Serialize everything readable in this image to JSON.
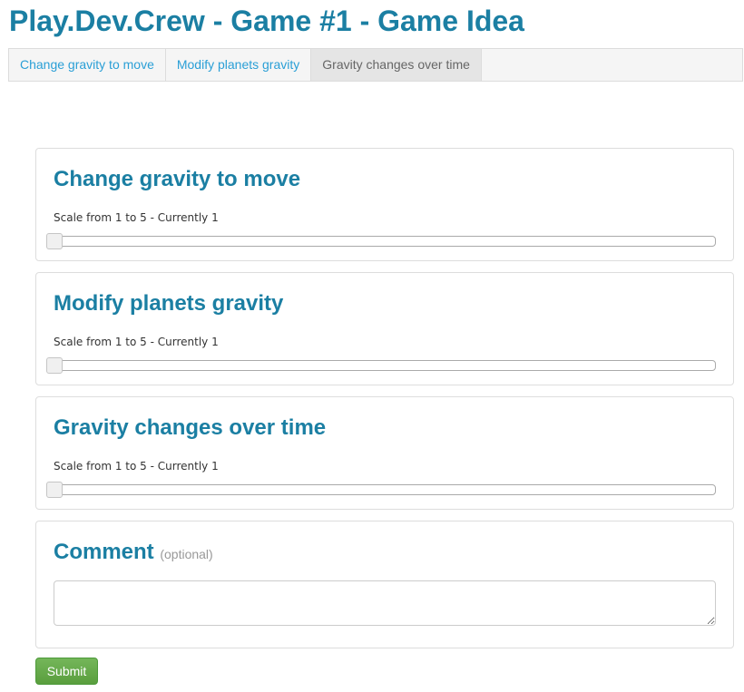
{
  "page": {
    "title": "Play.Dev.Crew - Game #1 - Game Idea"
  },
  "tabs": [
    {
      "label": "Change gravity to move",
      "active": false
    },
    {
      "label": "Modify planets gravity",
      "active": false
    },
    {
      "label": "Gravity changes over time",
      "active": true
    }
  ],
  "sections": [
    {
      "title": "Change gravity to move",
      "scale_label": "Scale from 1 to 5 - Currently 1",
      "value": 1,
      "min": 1,
      "max": 5
    },
    {
      "title": "Modify planets gravity",
      "scale_label": "Scale from 1 to 5 - Currently 1",
      "value": 1,
      "min": 1,
      "max": 5
    },
    {
      "title": "Gravity changes over time",
      "scale_label": "Scale from 1 to 5 - Currently 1",
      "value": 1,
      "min": 1,
      "max": 5
    }
  ],
  "comment": {
    "title": "Comment",
    "optional_label": "(optional)",
    "value": ""
  },
  "submit_label": "Submit",
  "colors": {
    "accent": "#1b7fa3",
    "link": "#2a9fd6",
    "submit": "#5a9e3e"
  }
}
